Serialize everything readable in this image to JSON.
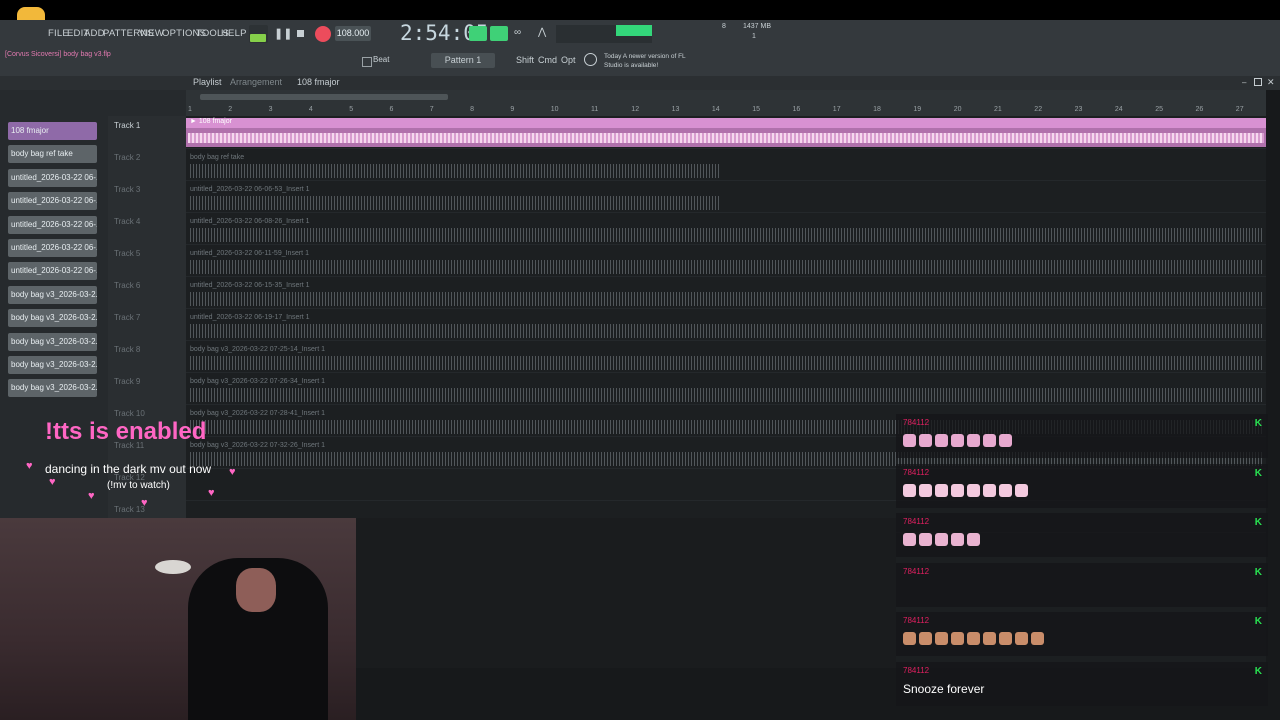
{
  "menu": {
    "items": [
      "FILE",
      "EDIT",
      "ADD",
      "PATTERNS",
      "VIEW",
      "OPTIONS",
      "TOOLS",
      "HELP"
    ],
    "project_label": "[Corvus Sicoversi] body bag v3.flp"
  },
  "transport": {
    "tempo": "108.000",
    "time": "2:54:05",
    "pattern": "Pattern 1",
    "snap": "Beat",
    "shift": "Shift",
    "cmd": "Cmd",
    "opt": "Opt",
    "mem_top": "1437 MB",
    "mem_bottom": "1",
    "cpu": "8",
    "news": "Today  A newer version of FL Studio is available!"
  },
  "playlist": {
    "title": "Playlist",
    "subtitle": "Arrangement",
    "pattern": "108 fmajor"
  },
  "ruler_ticks": [
    "1",
    "2",
    "3",
    "4",
    "5",
    "6",
    "7",
    "8",
    "9",
    "10",
    "11",
    "12",
    "13",
    "14",
    "15",
    "16",
    "17",
    "18",
    "19",
    "20",
    "21",
    "22",
    "23",
    "24",
    "25",
    "26",
    "27"
  ],
  "clips": [
    "108 fmajor",
    "body bag ref take",
    "untitled_2026-03-22 06-...",
    "untitled_2026-03-22 06-...",
    "untitled_2026-03-22 06-...",
    "untitled_2026-03-22 06-...",
    "untitled_2026-03-22 06-...",
    "body bag v3_2026-03-2...",
    "body bag v3_2026-03-2...",
    "body bag v3_2026-03-2...",
    "body bag v3_2026-03-2...",
    "body bag v3_2026-03-2..."
  ],
  "tracks": [
    {
      "label": "Track 1",
      "clip": "108 fmajor"
    },
    {
      "label": "Track 2",
      "clip": "body bag ref take"
    },
    {
      "label": "Track 3",
      "clip": "untitled_2026-03-22 06-06-53_Insert 1"
    },
    {
      "label": "Track 4",
      "clip": "untitled_2026-03-22 06-08-26_Insert 1"
    },
    {
      "label": "Track 5",
      "clip": "untitled_2026-03-22 06-11-59_Insert 1"
    },
    {
      "label": "Track 6",
      "clip": "untitled_2026-03-22 06-15-35_Insert 1"
    },
    {
      "label": "Track 7",
      "clip": "untitled_2026-03-22 06-19-17_Insert 1"
    },
    {
      "label": "Track 8",
      "clip": "body bag v3_2026-03-22 07-25-14_Insert 1"
    },
    {
      "label": "Track 9",
      "clip": "body bag v3_2026-03-22 07-26-34_Insert 1"
    },
    {
      "label": "Track 10",
      "clip": "body bag v3_2026-03-22 07-28-41_Insert 1"
    },
    {
      "label": "Track 11",
      "clip": "body bag v3_2026-03-22 07-32-26_Insert 1"
    },
    {
      "label": "Track 12",
      "clip": ""
    },
    {
      "label": "Track 13",
      "clip": ""
    }
  ],
  "overlay": {
    "tts": "!tts is enabled",
    "line1": "dancing in the dark mv out now",
    "line2": "(!mv to watch)"
  },
  "chat": [
    {
      "user": "784112",
      "text": "",
      "emote_count": 7,
      "emote_color": "#e7a9cf"
    },
    {
      "user": "784112",
      "text": "",
      "emote_count": 8,
      "emote_color": "#f3c9de"
    },
    {
      "user": "784112",
      "text": "",
      "emote_count": 5,
      "emote_color": "#e9b3d0"
    },
    {
      "user": "784112",
      "text": "",
      "emote_count": 0,
      "emote_color": "#000000"
    },
    {
      "user": "784112",
      "text": "",
      "emote_count": 9,
      "emote_color": "#c98d6a"
    },
    {
      "user": "784112",
      "text": "Snooze forever",
      "emote_count": 0,
      "emote_color": "#000000"
    }
  ],
  "colors": {
    "accent": "#e64c90",
    "waveform": "#9aa1a5",
    "first_track": "#c77bc1",
    "chat_k": "#28e050"
  }
}
